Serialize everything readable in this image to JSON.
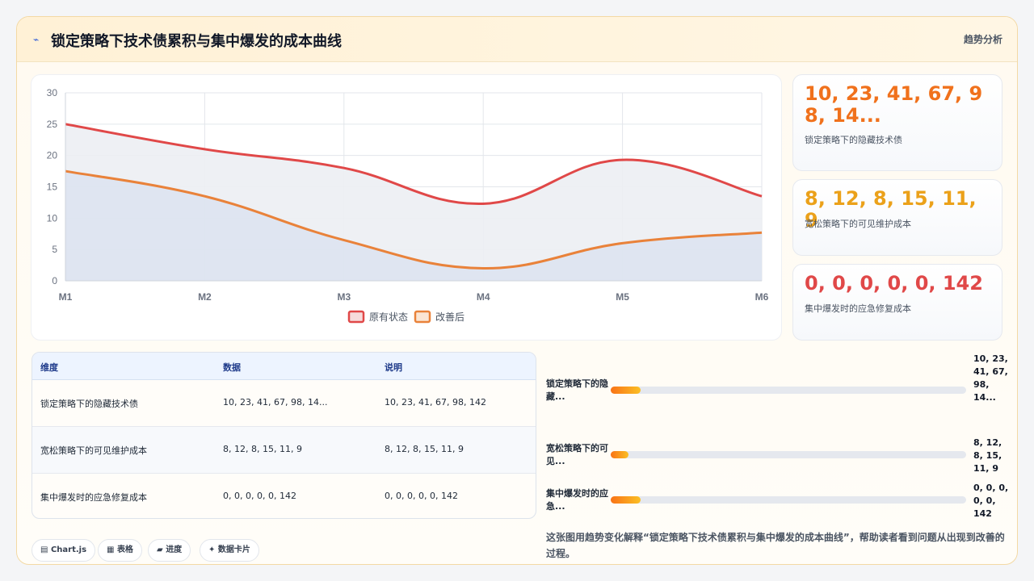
{
  "header": {
    "icon": "trend-line-icon",
    "title": "锁定策略下技术债累积与集中爆发的成本曲线",
    "tag": "趋势分析"
  },
  "chart_data": {
    "type": "area",
    "categories": [
      "M1",
      "M2",
      "M3",
      "M4",
      "M5",
      "M6"
    ],
    "ylim": [
      0,
      30
    ],
    "yticks": [
      0,
      5,
      10,
      15,
      20,
      25,
      30
    ],
    "grid": true,
    "legend_position": "bottom",
    "series": [
      {
        "name": "原有状态",
        "values": [
          25,
          21,
          18,
          12.3,
          19.3,
          13.5
        ],
        "color": "#e04848",
        "fill": "#eceef3"
      },
      {
        "name": "改善后",
        "values": [
          17.5,
          13.5,
          6.5,
          2,
          6,
          7.7
        ],
        "color": "#e9823a",
        "fill": "#dce3f0"
      }
    ]
  },
  "stats": [
    {
      "value": "10, 23, 41, 67, 98, 14...",
      "label": "锁定策略下的隐藏技术债",
      "color": "#f0711c"
    },
    {
      "value": "8, 12, 8, 15, 11, 9",
      "label": "宽松策略下的可见维护成本",
      "color": "#eba11a"
    },
    {
      "value": "0, 0, 0, 0, 0, 142",
      "label": "集中爆发时的应急修复成本",
      "color": "#e04848"
    }
  ],
  "table": {
    "headers": [
      "维度",
      "数据",
      "说明"
    ],
    "rows": [
      [
        "锁定策略下的隐藏技术债",
        "10, 23, 41, 67, 98, 14...",
        "10, 23, 41, 67, 98, 142"
      ],
      [
        "宽松策略下的可见维护成本",
        "8, 12, 8, 15, 11, 9",
        "8, 12, 8, 15, 11, 9"
      ],
      [
        "集中爆发时的应急修复成本",
        "0, 0, 0, 0, 0, 142",
        "0, 0, 0, 0, 0, 142"
      ]
    ]
  },
  "progress": [
    {
      "label": "锁定策略下的隐藏...",
      "value": "10, 23, 41, 67, 98, 14...",
      "fraction": 0.085
    },
    {
      "label": "宽松策略下的可见...",
      "value": "8, 12, 8, 15, 11, 9",
      "fraction": 0.05
    },
    {
      "label": "集中爆发时的应急...",
      "value": "0, 0, 0, 0, 0, 142",
      "fraction": 0.085
    }
  ],
  "chips": [
    {
      "icon": "chart-icon",
      "glyph": "▤",
      "label": "Chart.js"
    },
    {
      "icon": "table-icon",
      "glyph": "▦",
      "label": "表格"
    },
    {
      "icon": "progress-icon",
      "glyph": "▰",
      "label": "进度"
    },
    {
      "icon": "sparkle-icon",
      "glyph": "✦",
      "label": "数据卡片"
    }
  ],
  "caption": "这张图用趋势变化解释“锁定策略下技术债累积与集中爆发的成本曲线”，帮助读者看到问题从出现到改善的过程。"
}
